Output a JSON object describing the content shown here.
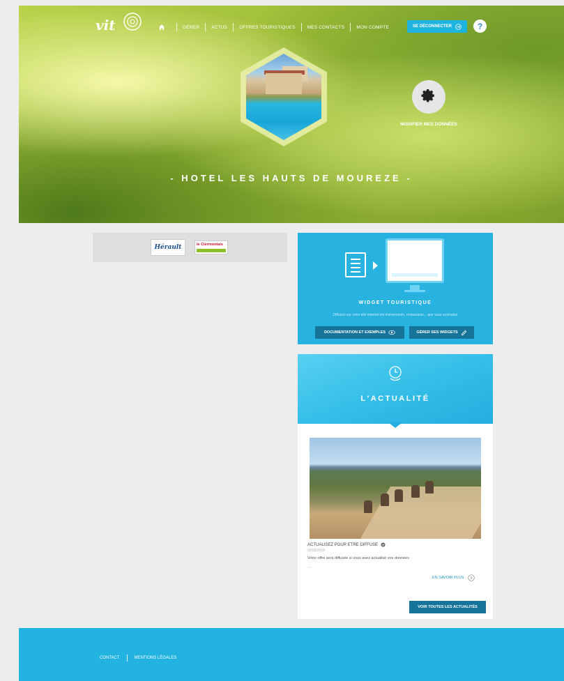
{
  "brand": {
    "logo_text": "vit"
  },
  "nav": {
    "items": [
      "GÉRER",
      "ACTUS",
      "OFFRES TOURISTIQUES",
      "MES CONTACTS",
      "MON COMPTE"
    ],
    "logout_label": "SE DÉCONNECTER",
    "help_label": "?"
  },
  "hero": {
    "title": "- HOTEL LES HAUTS DE MOUREZE -",
    "edit_label": "MODIFIER MES DONNÉES"
  },
  "partners": {
    "p1": "Hérault",
    "p2": "le Clermontais"
  },
  "widget": {
    "title": "WIDGET TOURISTIQUE",
    "description": "Diffusez sur votre site internet les événements, restaurants... que vous souhaitez",
    "doc_button": "DOCUMENTATION ET EXEMPLES",
    "manage_button": "GÉRER SES WIDGETS"
  },
  "news": {
    "title": "L'ACTUALITÉ",
    "headline": "ACTUALISEZ POUR ETRE DIFFUSE",
    "date": "02/03/2018",
    "text": "Votre offre sera diffusée si vous avez actualisé vos données",
    "ellipsis": "...",
    "more_label": "EN SAVOIR PLUS",
    "all_label": "VOIR TOUTES LES ACTUALITÉS"
  },
  "footer": {
    "links": [
      "CONTACT",
      "MENTIONS LÉGALES"
    ]
  },
  "colors": {
    "accent_blue": "#28b2e0",
    "dark_blue_button": "#16749a",
    "hero_green": "#9fbe38"
  }
}
